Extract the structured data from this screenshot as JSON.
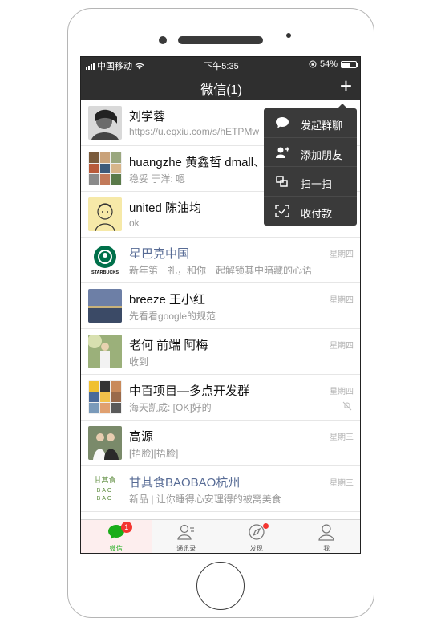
{
  "status": {
    "carrier": "中国移动",
    "time": "下午5:35",
    "battery": "54%",
    "battery_fraction": 0.54
  },
  "header": {
    "title": "微信(1)",
    "add_label": "+"
  },
  "menu": [
    {
      "label": "发起群聊",
      "icon": "chat-bubble-icon"
    },
    {
      "label": "添加朋友",
      "icon": "add-friend-icon"
    },
    {
      "label": "扫一扫",
      "icon": "scan-icon"
    },
    {
      "label": "收付款",
      "icon": "payment-icon"
    }
  ],
  "chats": [
    {
      "name": "刘学蓉",
      "message": "https://u.eqxiu.com/s/hETPMw",
      "time": ""
    },
    {
      "name": "huangzhe 黄鑫哲 dmall、",
      "message": "稳妥 于洋: 嗯",
      "time": ""
    },
    {
      "name": "united 陈油均",
      "message": "ok",
      "time": ""
    },
    {
      "name": "星巴克中国",
      "message": "新年第一礼，和你一起解锁其中暗藏的心语",
      "time": "星期四"
    },
    {
      "name": "breeze 王小红",
      "message": "先看看google的规范",
      "time": "星期四"
    },
    {
      "name": "老何 前端 阿梅",
      "message": "收到",
      "time": "星期四"
    },
    {
      "name": "中百项目—多点开发群",
      "message": "海天凯成: [OK]好的",
      "time": "星期四"
    },
    {
      "name": "高源",
      "message": "[捂脸][捂脸]",
      "time": "星期三"
    },
    {
      "name": "甘其食BAOBAO杭州",
      "message": "新品 | 让你睡得心安理得的被窝美食",
      "time": "星期三"
    }
  ],
  "logos": {
    "starbucks": "STARBUCKS",
    "ganqishi": [
      "甘其食",
      "BAO",
      "BAO"
    ]
  },
  "tabs": [
    {
      "label": "微信",
      "badge": "1"
    },
    {
      "label": "通讯录"
    },
    {
      "label": "发现"
    },
    {
      "label": "我"
    }
  ],
  "colors": {
    "accent": "#1aad19",
    "link": "#576b95",
    "badge": "#f43530",
    "bar": "#2f2f2f"
  }
}
